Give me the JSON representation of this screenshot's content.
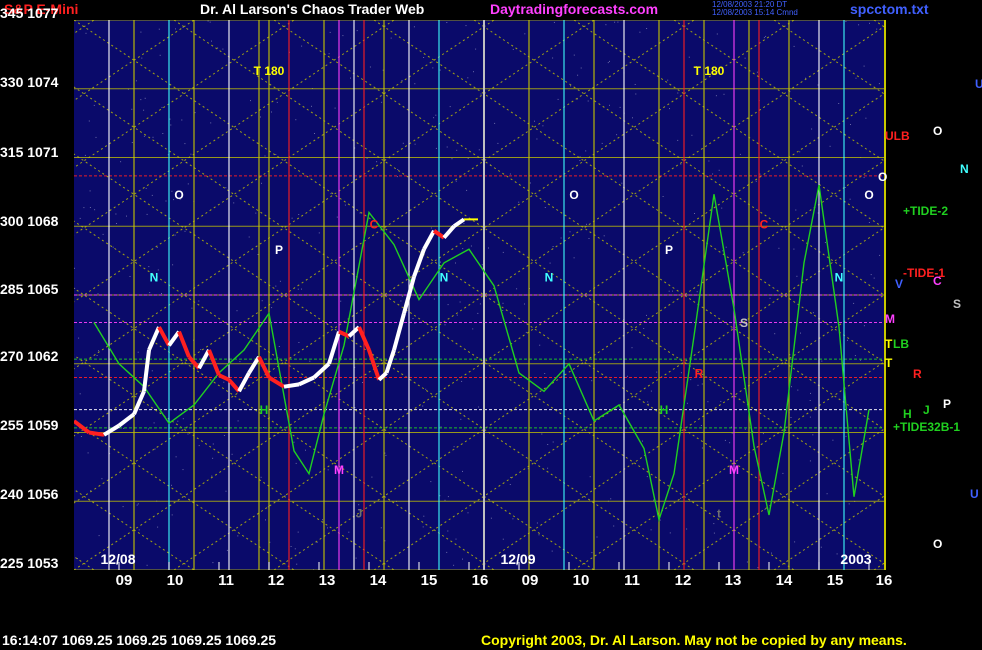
{
  "header": {
    "symbol": "S&P E-Mini",
    "author": "Dr. Al Larson's Chaos Trader Web",
    "site": "Daytradingforecasts.com",
    "stamp_line1": "12/08/2003 21:20 DT",
    "stamp_line2": "12/08/2003 15:14 Cmnd",
    "filename": "spcctom.txt"
  },
  "footer": {
    "quote": "16:14:07  1069.25  1069.25  1069.25  1069.25",
    "copyright": "Copyright 2003, Dr. Al Larson. May not be copied by any means."
  },
  "colors": {
    "background": "#0a0a6a",
    "grid": "#c8c800",
    "price_up": "#ffffff",
    "price_down": "#ff2020",
    "forecast": "#20d020",
    "symbol_text": "#ff2020",
    "author_text": "#ffffff",
    "site_text": "#ff40ff",
    "file_text": "#4060ff",
    "footer_text": "#ffff00"
  },
  "chart_data": {
    "type": "line",
    "y_left_labels": [
      "345",
      "330",
      "315",
      "300",
      "285",
      "270",
      "255",
      "240",
      "225"
    ],
    "y_right_labels": [
      "1077",
      "1074",
      "1071",
      "1068",
      "1065",
      "1062",
      "1059",
      "1056",
      "1053"
    ],
    "ylim_price": [
      1053,
      1077
    ],
    "x_tick_labels": [
      "09",
      "10",
      "11",
      "12",
      "13",
      "14",
      "15",
      "16",
      "09",
      "10",
      "11",
      "12",
      "13",
      "14",
      "15",
      "16"
    ],
    "x_tick_positions": [
      0.5,
      1.5,
      2.5,
      3.5,
      4.5,
      5.5,
      6.5,
      7.5,
      8.5,
      9.5,
      10.5,
      11.5,
      12.5,
      13.5,
      14.5,
      15.5
    ],
    "xlim": [
      -0.4,
      15.6
    ],
    "date_labels": [
      {
        "text": "12/08",
        "x": 0.0
      },
      {
        "text": "12/09",
        "x": 8.0
      }
    ],
    "year_label": "2003",
    "price_series": [
      {
        "x": -0.4,
        "y": 1059.5
      },
      {
        "x": -0.1,
        "y": 1059.0
      },
      {
        "x": 0.2,
        "y": 1058.9
      },
      {
        "x": 0.5,
        "y": 1059.3
      },
      {
        "x": 0.8,
        "y": 1059.8
      },
      {
        "x": 1.0,
        "y": 1060.8
      },
      {
        "x": 1.1,
        "y": 1062.6
      },
      {
        "x": 1.3,
        "y": 1063.6
      },
      {
        "x": 1.5,
        "y": 1062.8
      },
      {
        "x": 1.7,
        "y": 1063.4
      },
      {
        "x": 1.9,
        "y": 1062.3
      },
      {
        "x": 2.1,
        "y": 1061.8
      },
      {
        "x": 2.3,
        "y": 1062.6
      },
      {
        "x": 2.5,
        "y": 1061.5
      },
      {
        "x": 2.7,
        "y": 1061.3
      },
      {
        "x": 2.9,
        "y": 1060.8
      },
      {
        "x": 3.1,
        "y": 1061.6
      },
      {
        "x": 3.3,
        "y": 1062.3
      },
      {
        "x": 3.5,
        "y": 1061.4
      },
      {
        "x": 3.8,
        "y": 1061.0
      },
      {
        "x": 4.1,
        "y": 1061.1
      },
      {
        "x": 4.4,
        "y": 1061.4
      },
      {
        "x": 4.7,
        "y": 1062.0
      },
      {
        "x": 4.9,
        "y": 1063.4
      },
      {
        "x": 5.1,
        "y": 1063.2
      },
      {
        "x": 5.3,
        "y": 1063.6
      },
      {
        "x": 5.5,
        "y": 1062.6
      },
      {
        "x": 5.7,
        "y": 1061.3
      },
      {
        "x": 5.85,
        "y": 1061.6
      },
      {
        "x": 6.0,
        "y": 1062.6
      },
      {
        "x": 6.2,
        "y": 1064.2
      },
      {
        "x": 6.4,
        "y": 1065.8
      },
      {
        "x": 6.6,
        "y": 1067.0
      },
      {
        "x": 6.8,
        "y": 1067.8
      },
      {
        "x": 7.0,
        "y": 1067.5
      },
      {
        "x": 7.2,
        "y": 1068.0
      },
      {
        "x": 7.4,
        "y": 1068.3
      }
    ],
    "forecast_series": [
      {
        "x": 0.0,
        "y": 1063.8
      },
      {
        "x": 0.5,
        "y": 1062.0
      },
      {
        "x": 1.0,
        "y": 1061.0
      },
      {
        "x": 1.5,
        "y": 1059.4
      },
      {
        "x": 2.0,
        "y": 1060.2
      },
      {
        "x": 2.5,
        "y": 1061.6
      },
      {
        "x": 3.0,
        "y": 1062.6
      },
      {
        "x": 3.5,
        "y": 1064.2
      },
      {
        "x": 4.0,
        "y": 1058.2
      },
      {
        "x": 4.3,
        "y": 1057.2
      },
      {
        "x": 4.6,
        "y": 1059.8
      },
      {
        "x": 5.0,
        "y": 1062.8
      },
      {
        "x": 5.5,
        "y": 1068.6
      },
      {
        "x": 6.0,
        "y": 1067.2
      },
      {
        "x": 6.5,
        "y": 1064.8
      },
      {
        "x": 7.0,
        "y": 1066.4
      },
      {
        "x": 7.5,
        "y": 1067.0
      },
      {
        "x": 8.0,
        "y": 1065.4
      },
      {
        "x": 8.5,
        "y": 1061.6
      },
      {
        "x": 9.0,
        "y": 1060.8
      },
      {
        "x": 9.5,
        "y": 1062.0
      },
      {
        "x": 10.0,
        "y": 1059.5
      },
      {
        "x": 10.5,
        "y": 1060.2
      },
      {
        "x": 11.0,
        "y": 1058.3
      },
      {
        "x": 11.3,
        "y": 1055.2
      },
      {
        "x": 11.6,
        "y": 1057.2
      },
      {
        "x": 12.0,
        "y": 1063.2
      },
      {
        "x": 12.4,
        "y": 1069.4
      },
      {
        "x": 12.8,
        "y": 1064.4
      },
      {
        "x": 13.2,
        "y": 1058.4
      },
      {
        "x": 13.5,
        "y": 1055.4
      },
      {
        "x": 13.8,
        "y": 1059.0
      },
      {
        "x": 14.2,
        "y": 1066.4
      },
      {
        "x": 14.5,
        "y": 1069.8
      },
      {
        "x": 14.9,
        "y": 1063.6
      },
      {
        "x": 15.2,
        "y": 1056.2
      },
      {
        "x": 15.5,
        "y": 1060.0
      }
    ],
    "vertical_time_lines": [
      {
        "x": 0.3,
        "color": "#ffffff"
      },
      {
        "x": 0.8,
        "color": "#c8c800"
      },
      {
        "x": 1.5,
        "color": "#40ffff"
      },
      {
        "x": 2.0,
        "color": "#c8c800"
      },
      {
        "x": 2.7,
        "color": "#ffffff"
      },
      {
        "x": 3.3,
        "color": "#c8c800"
      },
      {
        "x": 3.5,
        "color": "#c8c800"
      },
      {
        "x": 3.9,
        "color": "#ff2020"
      },
      {
        "x": 4.6,
        "color": "#c8c800"
      },
      {
        "x": 4.9,
        "color": "#ff40ff"
      },
      {
        "x": 5.2,
        "color": "#ffffff"
      },
      {
        "x": 5.4,
        "color": "#ff2020"
      },
      {
        "x": 5.8,
        "color": "#c8c800"
      },
      {
        "x": 6.3,
        "color": "#ffffff"
      },
      {
        "x": 6.9,
        "color": "#40ffff"
      },
      {
        "x": 7.8,
        "color": "#ffffff"
      },
      {
        "x": 8.7,
        "color": "#c8c800"
      },
      {
        "x": 9.4,
        "color": "#40ffff"
      },
      {
        "x": 10.0,
        "color": "#c8c800"
      },
      {
        "x": 10.6,
        "color": "#ffffff"
      },
      {
        "x": 11.3,
        "color": "#c8c800"
      },
      {
        "x": 11.8,
        "color": "#ff2020"
      },
      {
        "x": 12.2,
        "color": "#c8c800"
      },
      {
        "x": 12.8,
        "color": "#ff40ff"
      },
      {
        "x": 13.1,
        "color": "#c8c800"
      },
      {
        "x": 13.3,
        "color": "#ff2020"
      },
      {
        "x": 13.9,
        "color": "#c8c800"
      },
      {
        "x": 14.5,
        "color": "#ffffff"
      },
      {
        "x": 15.0,
        "color": "#40ffff"
      }
    ],
    "horizontal_levels": [
      {
        "y": 1070.2,
        "color": "#ff2020"
      },
      {
        "y": 1065.0,
        "color": "#ff40ff"
      },
      {
        "y": 1063.8,
        "color": "#ff40ff"
      },
      {
        "y": 1062.2,
        "color": "#20d020"
      },
      {
        "y": 1061.4,
        "color": "#ff2020"
      },
      {
        "y": 1060.0,
        "color": "#ffffff"
      },
      {
        "y": 1059.2,
        "color": "#20d020"
      }
    ],
    "chart_annotations": [
      {
        "text": "T 180",
        "x": 3.5,
        "y": 1074.6,
        "color": "#ffff00"
      },
      {
        "text": "T 180",
        "x": 12.3,
        "y": 1074.6,
        "color": "#ffff00"
      },
      {
        "text": "O",
        "x": 1.7,
        "y": 1069.2,
        "color": "#ffffff"
      },
      {
        "text": "O",
        "x": 9.6,
        "y": 1069.2,
        "color": "#ffffff"
      },
      {
        "text": "O",
        "x": 15.5,
        "y": 1069.2,
        "color": "#ffffff"
      },
      {
        "text": "N",
        "x": 1.2,
        "y": 1065.6,
        "color": "#40ffff"
      },
      {
        "text": "N",
        "x": 7.0,
        "y": 1065.6,
        "color": "#40ffff"
      },
      {
        "text": "N",
        "x": 9.1,
        "y": 1065.6,
        "color": "#40ffff"
      },
      {
        "text": "N",
        "x": 14.9,
        "y": 1065.6,
        "color": "#40ffff"
      },
      {
        "text": "P",
        "x": 3.7,
        "y": 1066.8,
        "color": "#ffffff"
      },
      {
        "text": "P",
        "x": 11.5,
        "y": 1066.8,
        "color": "#ffffff"
      },
      {
        "text": "C",
        "x": 5.6,
        "y": 1067.9,
        "color": "#ff2020"
      },
      {
        "text": "C",
        "x": 13.4,
        "y": 1067.9,
        "color": "#ff2020"
      },
      {
        "text": "S",
        "x": 13.0,
        "y": 1063.6,
        "color": "#c0c0c0"
      },
      {
        "text": "H",
        "x": 3.4,
        "y": 1059.8,
        "color": "#20d020"
      },
      {
        "text": "H",
        "x": 11.4,
        "y": 1059.8,
        "color": "#20d020"
      },
      {
        "text": "R",
        "x": 12.1,
        "y": 1061.4,
        "color": "#ff2020"
      },
      {
        "text": "M",
        "x": 4.9,
        "y": 1057.2,
        "color": "#ff40ff"
      },
      {
        "text": "M",
        "x": 12.8,
        "y": 1057.2,
        "color": "#ff40ff"
      },
      {
        "text": "J",
        "x": 5.3,
        "y": 1055.3,
        "color": "#707070"
      },
      {
        "text": "t",
        "x": 12.5,
        "y": 1055.3,
        "color": "#707070"
      }
    ],
    "right_side_labels": [
      {
        "text": "U",
        "x": 975,
        "y": 85,
        "color": "#4060ff"
      },
      {
        "text": "ULB",
        "x": 885,
        "y": 137,
        "color": "#ff2020"
      },
      {
        "text": "O",
        "x": 933,
        "y": 132,
        "color": "#ffffff"
      },
      {
        "text": "N",
        "x": 960,
        "y": 170,
        "color": "#40ffff"
      },
      {
        "text": "O",
        "x": 878,
        "y": 178,
        "color": "#ffffff"
      },
      {
        "text": "+TIDE-2",
        "x": 903,
        "y": 212,
        "color": "#20d020"
      },
      {
        "text": "-TIDE-1",
        "x": 903,
        "y": 274,
        "color": "#ff2020"
      },
      {
        "text": "C",
        "x": 933,
        "y": 282,
        "color": "#ff40ff"
      },
      {
        "text": "V",
        "x": 895,
        "y": 285,
        "color": "#4060ff"
      },
      {
        "text": "S",
        "x": 953,
        "y": 305,
        "color": "#c0c0c0"
      },
      {
        "text": "M",
        "x": 885,
        "y": 320,
        "color": "#ff40ff"
      },
      {
        "text": "T",
        "x": 885,
        "y": 345,
        "color": "#ffff00"
      },
      {
        "text": "LB",
        "x": 893,
        "y": 345,
        "color": "#20d020"
      },
      {
        "text": "T",
        "x": 885,
        "y": 364,
        "color": "#ffff00"
      },
      {
        "text": "R",
        "x": 913,
        "y": 375,
        "color": "#ff2020"
      },
      {
        "text": "P",
        "x": 943,
        "y": 405,
        "color": "#ffffff"
      },
      {
        "text": "H",
        "x": 903,
        "y": 415,
        "color": "#20d020"
      },
      {
        "text": "J",
        "x": 923,
        "y": 411,
        "color": "#20d020"
      },
      {
        "text": "+TIDE32B-1",
        "x": 893,
        "y": 428,
        "color": "#20d020"
      },
      {
        "text": "U",
        "x": 970,
        "y": 495,
        "color": "#4060ff"
      },
      {
        "text": "O",
        "x": 933,
        "y": 545,
        "color": "#ffffff"
      }
    ]
  }
}
